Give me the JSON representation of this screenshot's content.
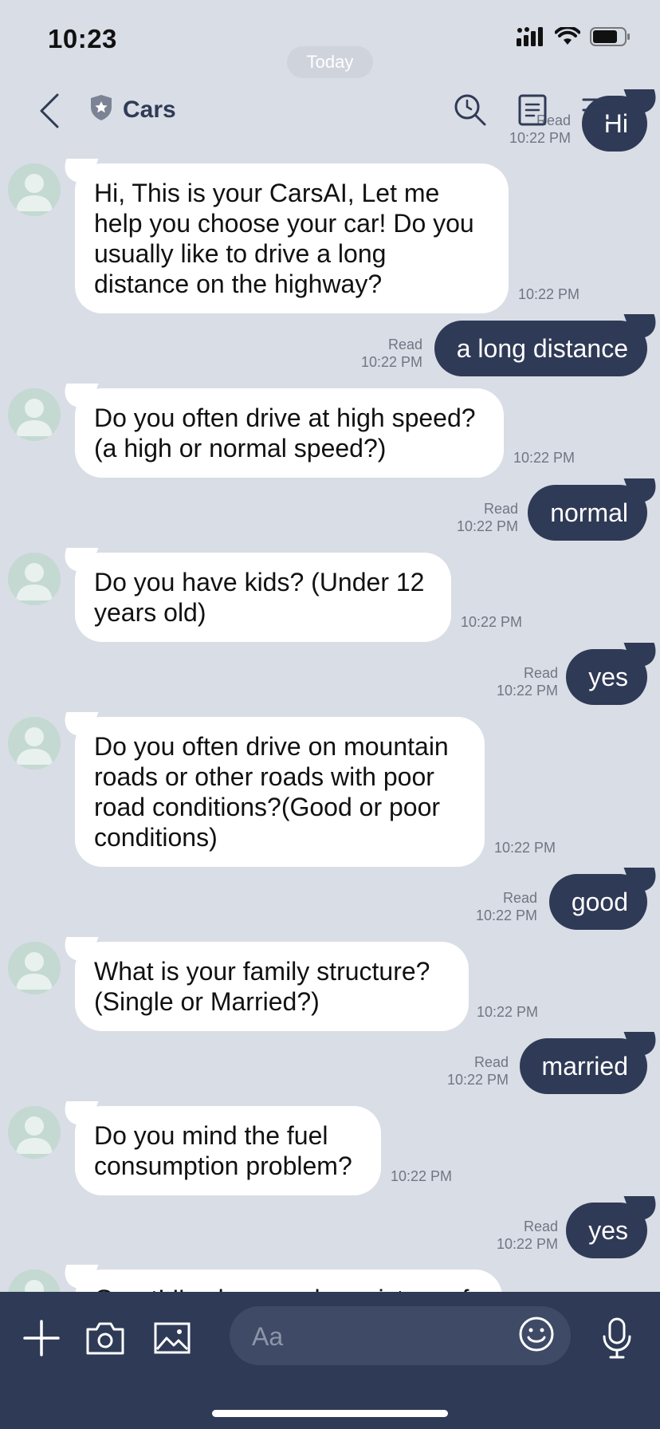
{
  "status_bar": {
    "time": "10:23"
  },
  "header": {
    "title": "Cars"
  },
  "date_separator": "Today",
  "messages": [
    {
      "dir": "out",
      "text": "Hi",
      "read": "Read",
      "time": "10:22 PM"
    },
    {
      "dir": "in",
      "text": "Hi, This is your CarsAI, Let me help you choose your car! Do you usually like to drive a long distance on the highway?",
      "time": "10:22 PM"
    },
    {
      "dir": "out",
      "text": "a long distance",
      "read": "Read",
      "time": "10:22 PM"
    },
    {
      "dir": "in",
      "text": "Do you often drive at high speed?(a high or normal speed?)",
      "time": "10:22 PM"
    },
    {
      "dir": "out",
      "text": "normal",
      "read": "Read",
      "time": "10:22 PM"
    },
    {
      "dir": "in",
      "text": "Do you have kids? (Under 12 years old)",
      "time": "10:22 PM"
    },
    {
      "dir": "out",
      "text": "yes",
      "read": "Read",
      "time": "10:22 PM"
    },
    {
      "dir": "in",
      "text": "Do you often drive on mountain roads or other roads with poor road conditions?(Good or poor conditions)",
      "time": "10:22 PM"
    },
    {
      "dir": "out",
      "text": "good",
      "read": "Read",
      "time": "10:22 PM"
    },
    {
      "dir": "in",
      "text": "What is your family structure?(Single or Married?)",
      "time": "10:22 PM"
    },
    {
      "dir": "out",
      "text": "married",
      "read": "Read",
      "time": "10:22 PM"
    },
    {
      "dir": "in",
      "text": "Do you mind the fuel consumption problem?",
      "time": "10:22 PM"
    },
    {
      "dir": "out",
      "text": "yes",
      "read": "Read",
      "time": "10:22 PM"
    },
    {
      "dir": "in",
      "text": "Great! I've have a clear picture of",
      "time": ""
    }
  ],
  "composer": {
    "placeholder": "Aa"
  },
  "colors": {
    "background": "#d9dde5",
    "outgoing_bubble": "#2f3a56",
    "incoming_bubble": "#ffffff",
    "composer_bar": "#2e3a56"
  }
}
